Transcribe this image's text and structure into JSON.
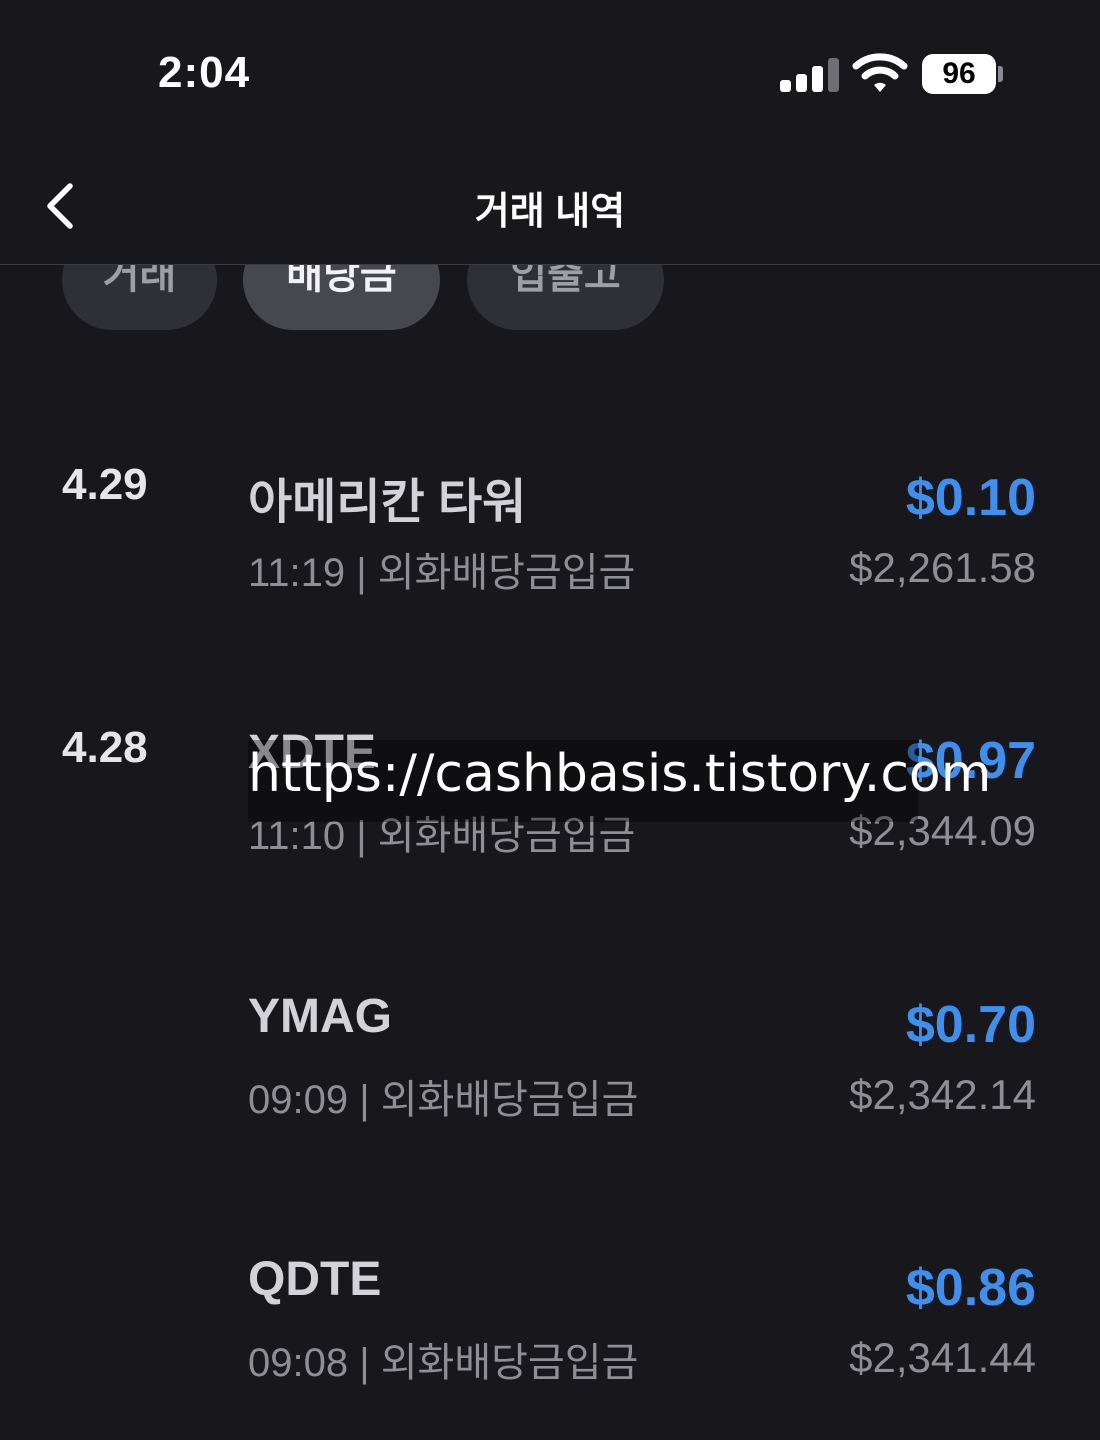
{
  "status_bar": {
    "time": "2:04",
    "battery": "96"
  },
  "nav": {
    "title": "거래 내역",
    "back_icon": "chevron-left-icon"
  },
  "tabs": [
    {
      "label": "거래",
      "active": false
    },
    {
      "label": "배당금",
      "active": true
    },
    {
      "label": "입출고",
      "active": false
    }
  ],
  "transactions": [
    {
      "date": "4.29",
      "name": "아메리칸 타워",
      "detail": "11:19 | 외화배당금입금",
      "amount": "$0.10",
      "balance": "$2,261.58"
    },
    {
      "date": "4.28",
      "name": "XDTE",
      "detail": "11:10 | 외화배당금입금",
      "amount": "$0.97",
      "balance": "$2,344.09"
    },
    {
      "date": "",
      "name": "YMAG",
      "detail": "09:09 | 외화배당금입금",
      "amount": "$0.70",
      "balance": "$2,342.14"
    },
    {
      "date": "",
      "name": "QDTE",
      "detail": "09:08 | 외화배당금입금",
      "amount": "$0.86",
      "balance": "$2,341.44"
    }
  ],
  "watermark": "https://cashbasis.tistory.com",
  "colors": {
    "background": "#17171c",
    "amount_blue": "#3d8ff0",
    "muted_gray": "#8e8e96"
  }
}
